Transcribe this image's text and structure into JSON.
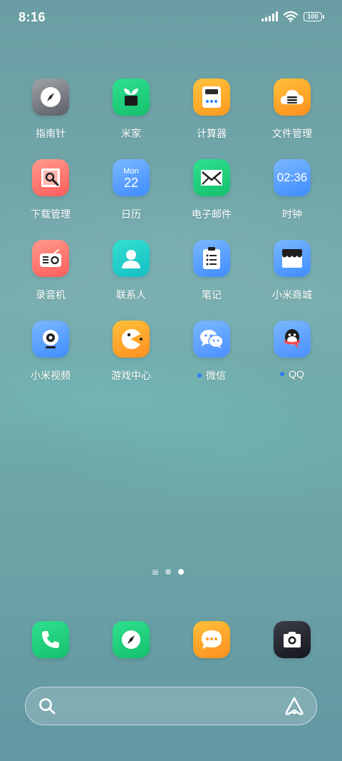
{
  "status": {
    "time": "8:16",
    "battery": "100"
  },
  "apps": [
    {
      "label": "指南针",
      "icon": "compass-icon"
    },
    {
      "label": "米家",
      "icon": "mijia-icon"
    },
    {
      "label": "计算器",
      "icon": "calculator-icon"
    },
    {
      "label": "文件管理",
      "icon": "file-manager-icon"
    },
    {
      "label": "下载管理",
      "icon": "download-manager-icon"
    },
    {
      "label": "日历",
      "icon": "calendar-icon",
      "day": "Mon",
      "date": "22"
    },
    {
      "label": "电子邮件",
      "icon": "email-icon"
    },
    {
      "label": "时钟",
      "icon": "clock-icon",
      "clock_time": "02:36"
    },
    {
      "label": "录音机",
      "icon": "recorder-icon"
    },
    {
      "label": "联系人",
      "icon": "contacts-icon"
    },
    {
      "label": "笔记",
      "icon": "notes-icon"
    },
    {
      "label": "小米商城",
      "icon": "mi-store-icon"
    },
    {
      "label": "小米视频",
      "icon": "mi-video-icon"
    },
    {
      "label": "游戏中心",
      "icon": "game-center-icon"
    },
    {
      "label": "微信",
      "icon": "wechat-icon"
    },
    {
      "label": "QQ",
      "icon": "qq-icon"
    }
  ],
  "dock": [
    {
      "icon": "phone-icon"
    },
    {
      "icon": "browser-icon"
    },
    {
      "icon": "messages-icon"
    },
    {
      "icon": "camera-icon"
    }
  ],
  "search": {
    "icon": "search-icon",
    "assistant_icon": "ai-assistant-icon"
  },
  "colors": {
    "accent_blue": "#2e7cf6",
    "wallpaper": "#6fa4a8"
  }
}
